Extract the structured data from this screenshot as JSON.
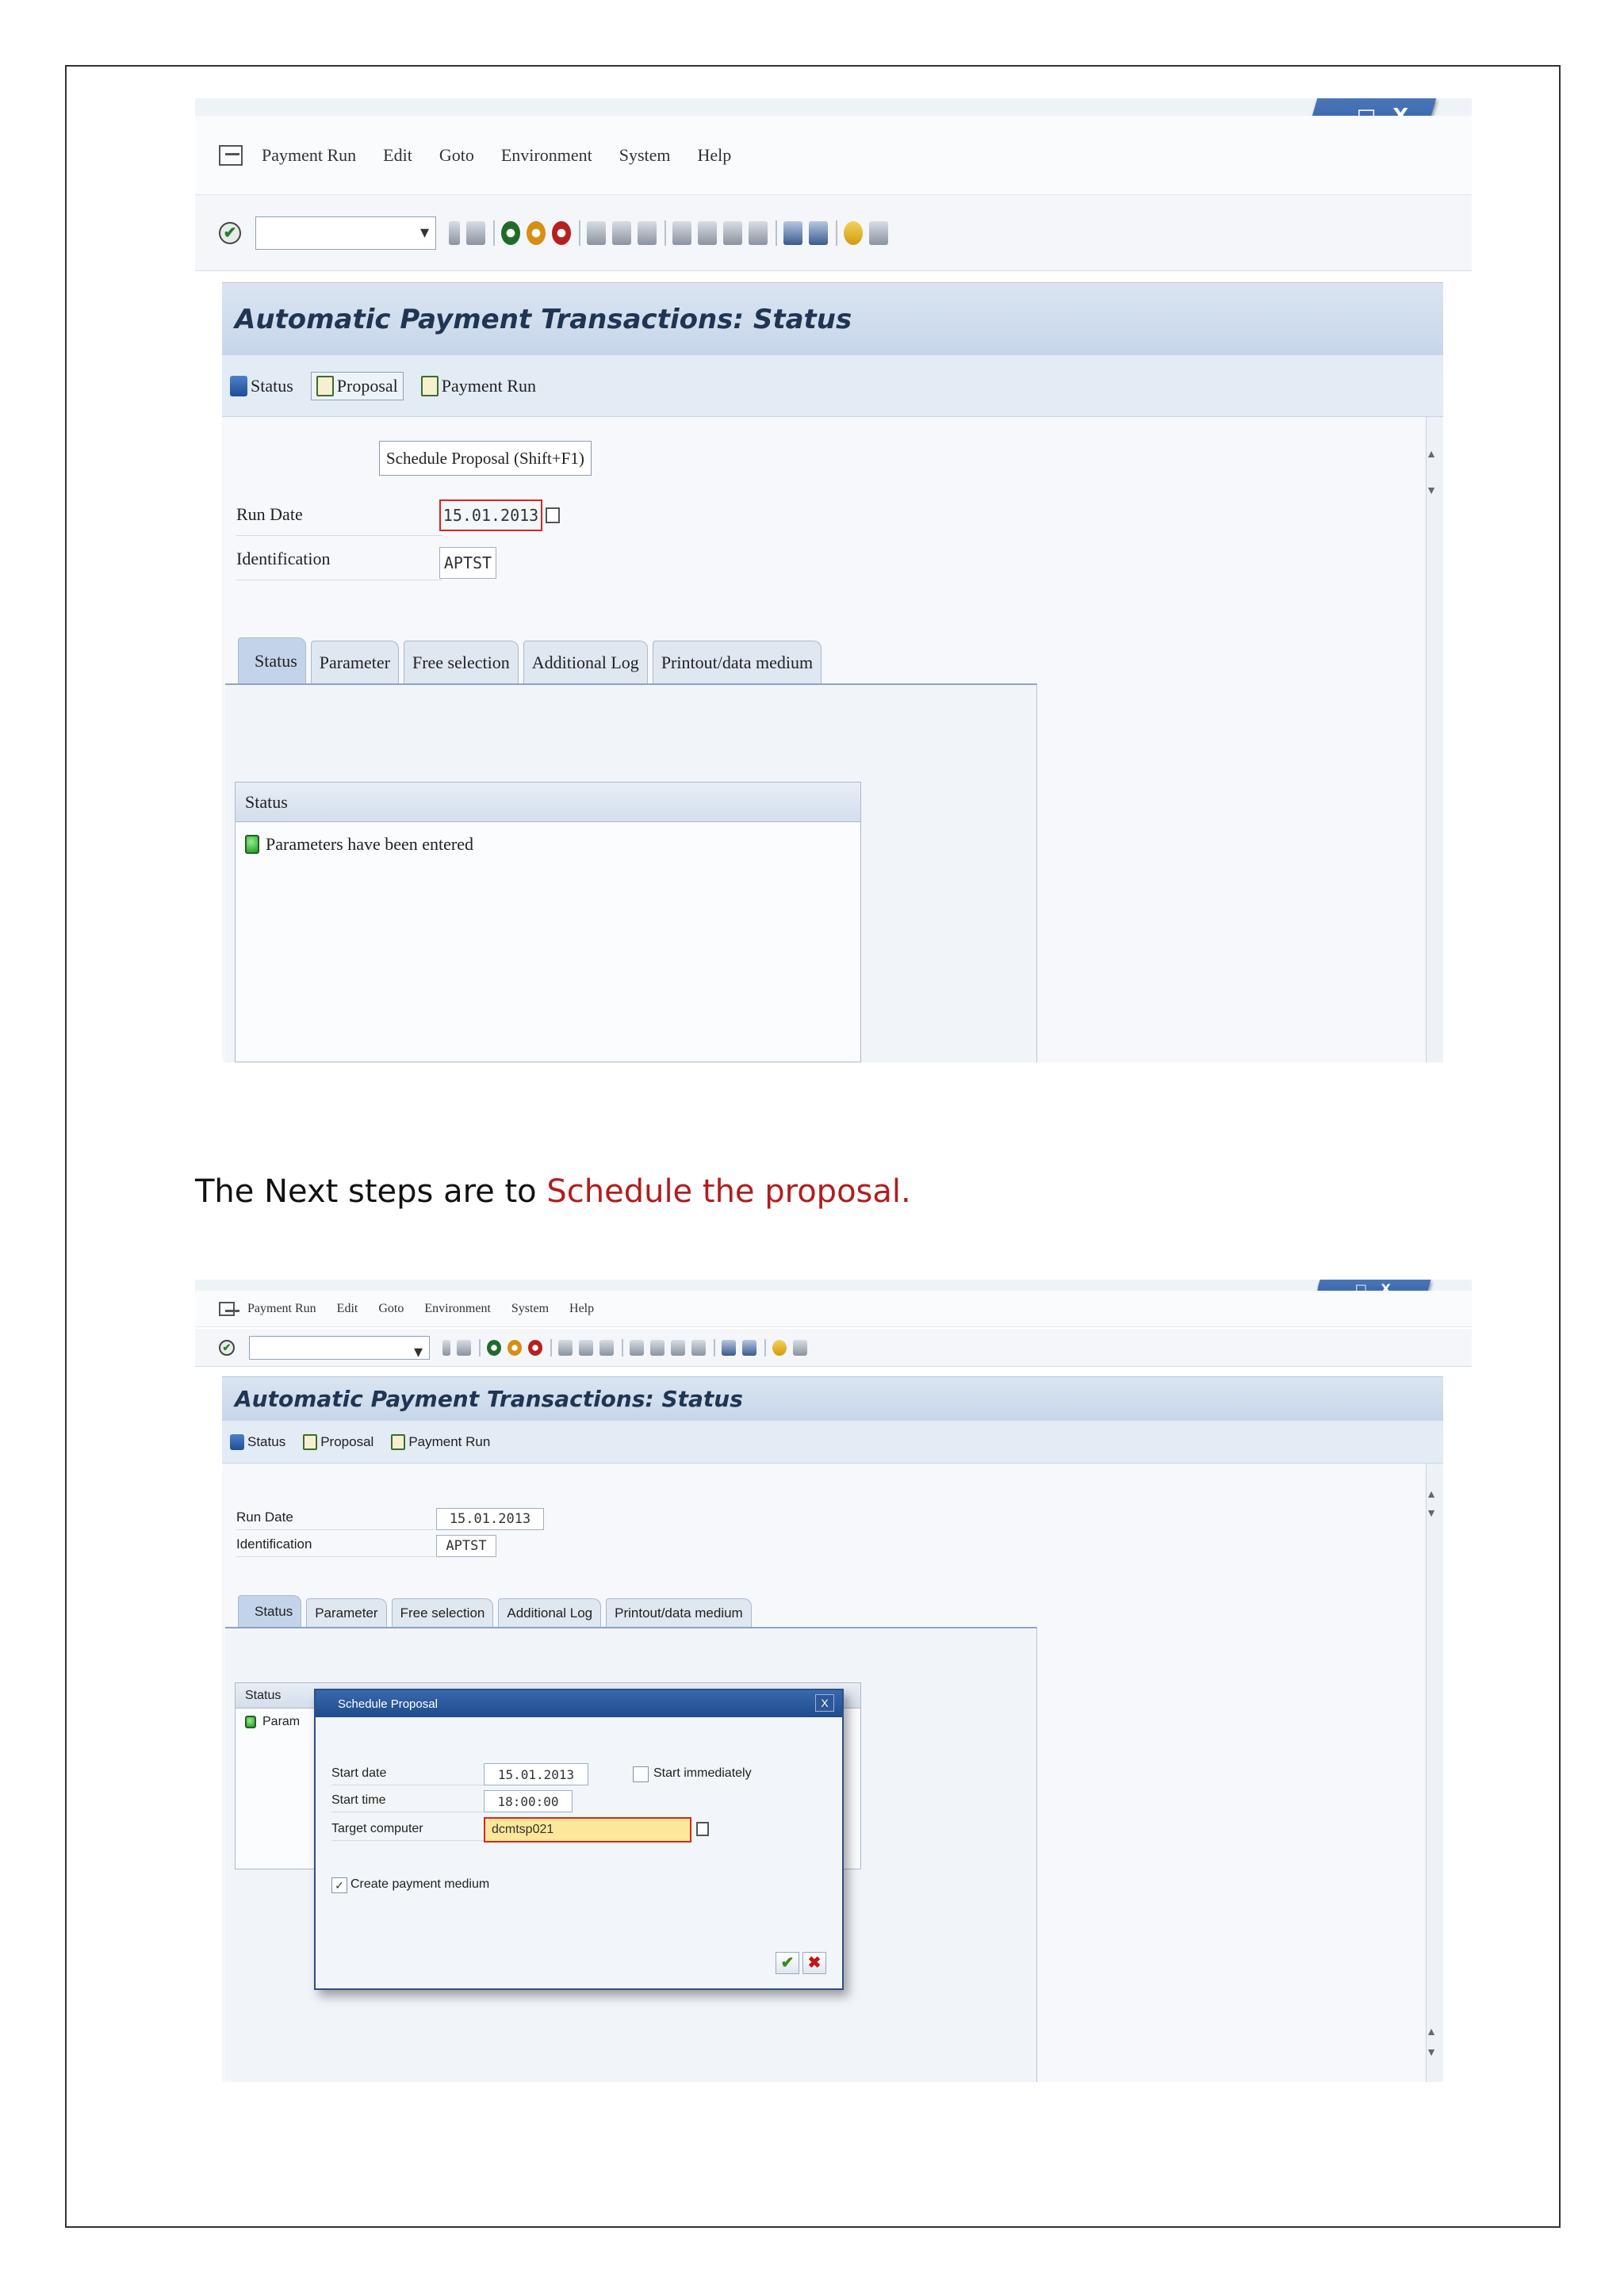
{
  "screenshot_top": {
    "menu": [
      "Payment Run",
      "Edit",
      "Goto",
      "Environment",
      "System",
      "Help"
    ],
    "window_controls": "_ □ X",
    "ok_icon": "✔",
    "title": "Automatic Payment Transactions: Status",
    "app_toolbar": [
      "Status",
      "Proposal",
      "Payment Run"
    ],
    "tooltip": "Schedule Proposal  (Shift+F1)",
    "run_date_label": "Run Date",
    "run_date_value": "15.01.2013",
    "identification_label": "Identification",
    "identification_value": "APTST",
    "tabs": [
      "Status",
      "Parameter",
      "Free selection",
      "Additional Log",
      "Printout/data medium"
    ],
    "status_header": "Status",
    "status_message": "Parameters have been entered"
  },
  "caption": {
    "prefix": "The Next steps are to ",
    "highlight": "Schedule the proposal."
  },
  "screenshot_bottom": {
    "menu": [
      "Payment Run",
      "Edit",
      "Goto",
      "Environment",
      "System",
      "Help"
    ],
    "window_controls": "_ □ X",
    "ok_icon": "✔",
    "title": "Automatic Payment Transactions: Status",
    "app_toolbar": [
      "Status",
      "Proposal",
      "Payment Run"
    ],
    "run_date_label": "Run Date",
    "run_date_value": "15.01.2013",
    "identification_label": "Identification",
    "identification_value": "APTST",
    "tabs": [
      "Status",
      "Parameter",
      "Free selection",
      "Additional Log",
      "Printout/data medium"
    ],
    "status_header": "Status",
    "status_message_partial": "Param",
    "dialog": {
      "title": "Schedule Proposal",
      "close": "X",
      "start_date_label": "Start date",
      "start_date_value": "15.01.2013",
      "start_immediately_label": "Start immediately",
      "start_time_label": "Start time",
      "start_time_value": "18:00:00",
      "target_computer_label": "Target computer",
      "target_computer_value": "dcmtsp021",
      "create_payment_medium_label": "Create payment medium",
      "create_payment_medium_checked": "✓",
      "ok_symbol": "✔",
      "cancel_symbol": "✖"
    }
  },
  "colors": {
    "caption_highlight": "#b21d1d",
    "required_border": "#d8261c",
    "dialog_header": "#2e5a9c"
  }
}
